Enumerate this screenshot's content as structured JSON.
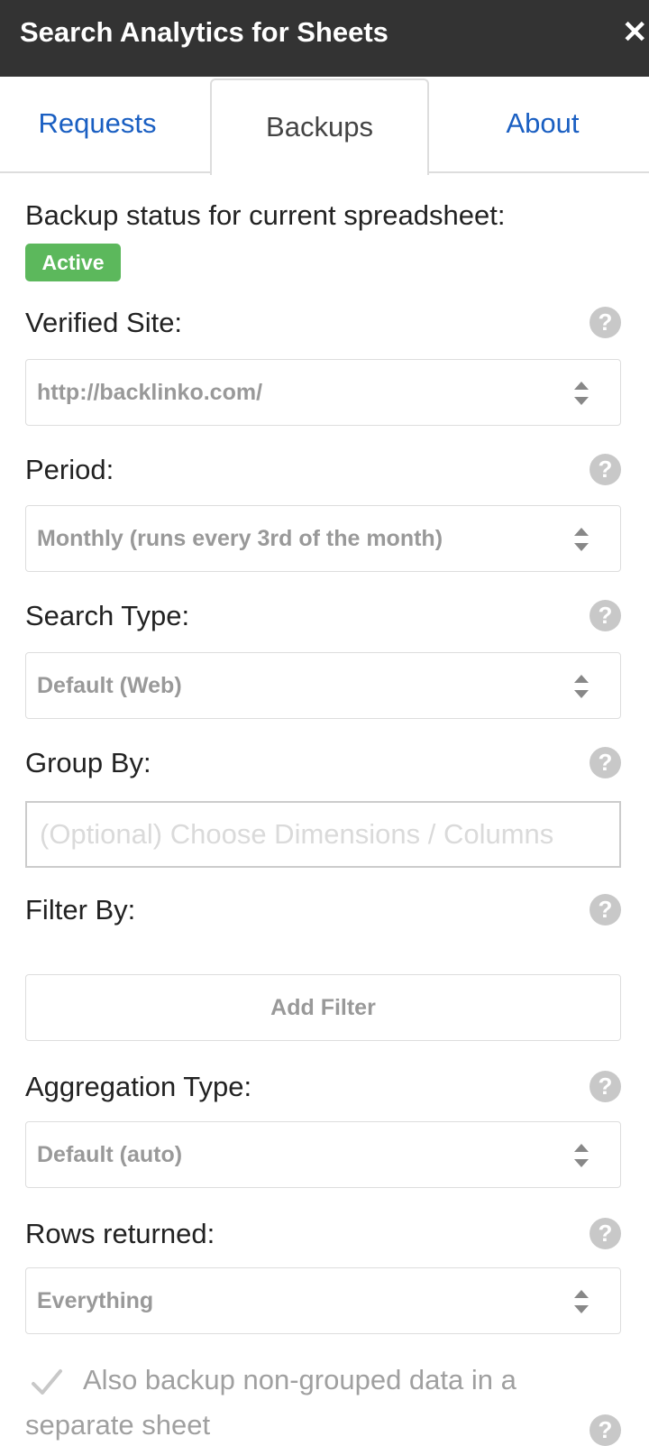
{
  "app": {
    "title": "Search Analytics for Sheets",
    "close_glyph": "✕"
  },
  "tabs": [
    {
      "label": "Requests",
      "active": false
    },
    {
      "label": "Backups",
      "active": true
    },
    {
      "label": "About",
      "active": false
    }
  ],
  "status": {
    "label": "Backup status for current spreadsheet:",
    "badge": "Active",
    "badge_color": "#5cb85c"
  },
  "fields": {
    "verified_site": {
      "label": "Verified Site:",
      "value": "http://backlinko.com/"
    },
    "period": {
      "label": "Period:",
      "value": "Monthly (runs every 3rd of the month)"
    },
    "search_type": {
      "label": "Search Type:",
      "value": "Default (Web)"
    },
    "group_by": {
      "label": "Group By:",
      "placeholder": "(Optional) Choose Dimensions / Columns"
    },
    "filter_by": {
      "label": "Filter By:",
      "button": "Add Filter"
    },
    "aggregation_type": {
      "label": "Aggregation Type:",
      "value": "Default (auto)"
    },
    "rows_returned": {
      "label": "Rows returned:",
      "value": "Everything"
    }
  },
  "options": {
    "nongrouped": {
      "label_line1": "Also backup non-grouped data in a",
      "label_line2": "separate sheet",
      "checked": true
    }
  },
  "help_glyph": "?",
  "colors": {
    "titlebar": "#333333",
    "link": "#1a5fc2",
    "active_badge": "#5cb85c"
  },
  "icons": {
    "help": "question-circle-icon",
    "select": "sort-arrows-icon",
    "check": "checkmark-icon",
    "close": "close-icon"
  }
}
